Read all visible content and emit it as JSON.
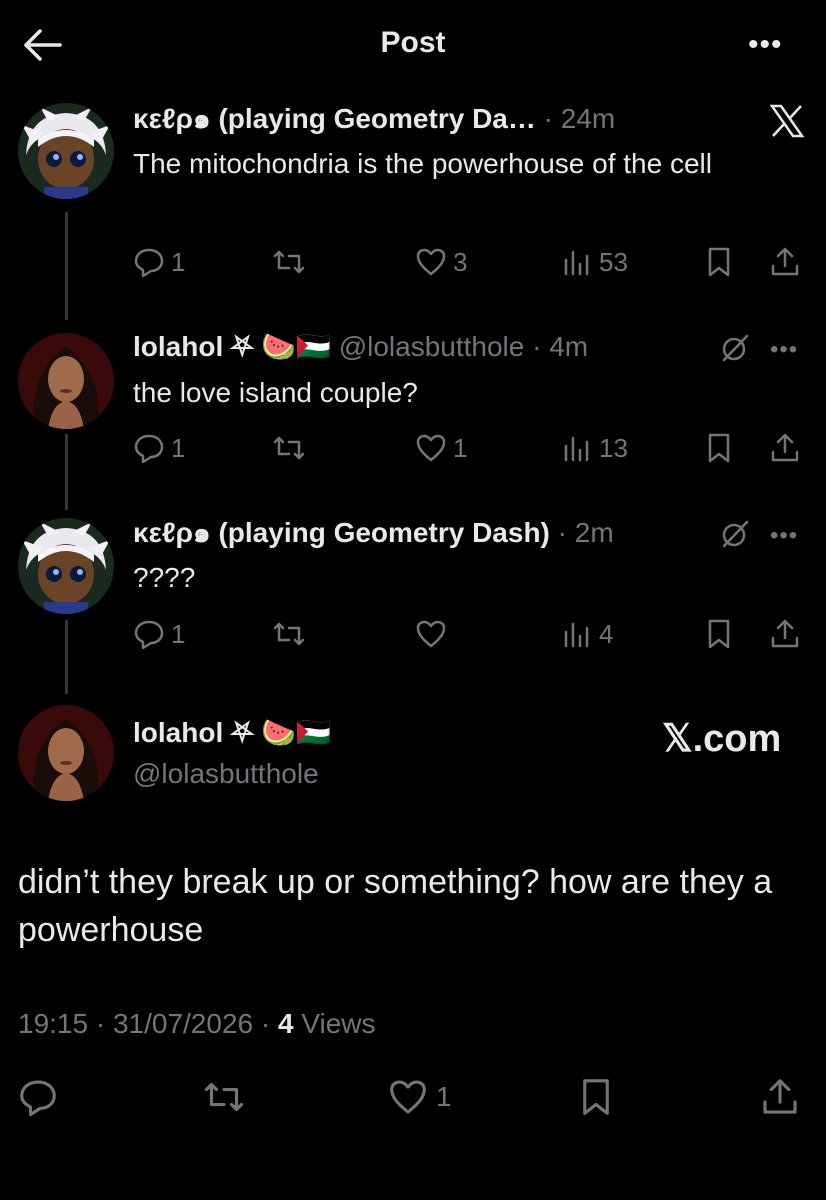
{
  "topbar": {
    "title": "Post",
    "back_icon": "arrow-left-icon",
    "more_icon": "more-horizontal-icon",
    "more_label": "•••"
  },
  "colors": {
    "background": "#000000",
    "text": "#e7e9ea",
    "muted": "#71767b",
    "thread_line": "#333639"
  },
  "thread": [
    {
      "name": "κεℓρ๑ (playing Geometry Da…",
      "handle": "",
      "time": "· 24m",
      "text": "The mitochondria is the powerhouse of the cell",
      "replies": "1",
      "reposts": "",
      "likes": "3",
      "views": "53",
      "corner_icon": "x-logo-icon"
    },
    {
      "name": "lolahol ⛧ 🍉🇵🇸",
      "handle": "@lolasbutthole",
      "time": "· 4m",
      "text": "the love island couple?",
      "replies": "1",
      "reposts": "",
      "likes": "1",
      "views": "13",
      "corner_icon": "grok-icon",
      "more": "•••"
    },
    {
      "name": "κεℓρ๑ (playing Geometry Dash)",
      "handle": "",
      "time": "· 2m",
      "text": "????",
      "replies": "1",
      "reposts": "",
      "likes": "",
      "views": "4",
      "corner_icon": "grok-icon",
      "more": "•••"
    }
  ],
  "main_post": {
    "name": "lolahol ⛧ 🍉🇵🇸",
    "handle": "@lolasbutthole",
    "watermark": "𝕏.com",
    "text": "didn’t they break up or something? how are they a powerhouse",
    "time": "19:15 · 31/07/2026 ·",
    "views_count": "4",
    "views_label": "Views",
    "likes": "1"
  }
}
